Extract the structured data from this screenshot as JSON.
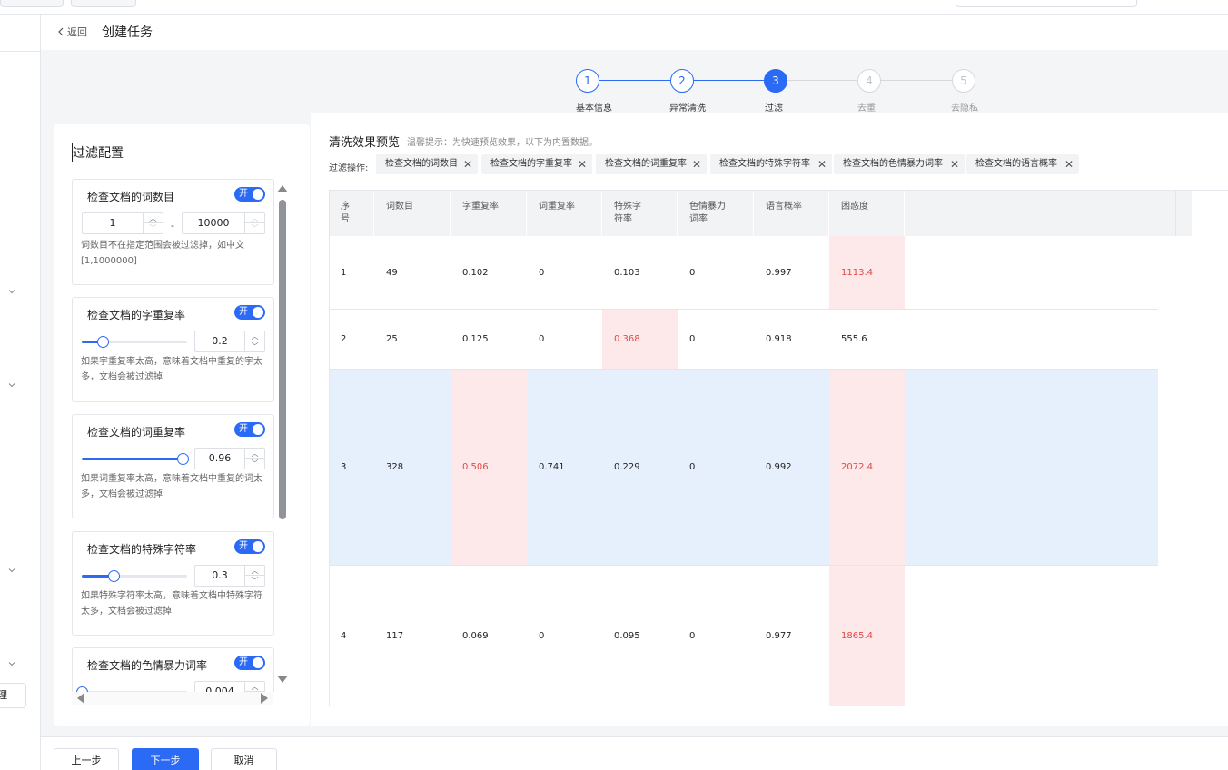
{
  "header": {
    "back_label": "返回",
    "title": "创建任务"
  },
  "nav": {
    "partial_item_label": "理"
  },
  "steps": [
    {
      "num": "1",
      "label": "基本信息",
      "state": "done"
    },
    {
      "num": "2",
      "label": "异常清洗",
      "state": "done"
    },
    {
      "num": "3",
      "label": "过滤",
      "state": "active"
    },
    {
      "num": "4",
      "label": "去重",
      "state": "todo"
    },
    {
      "num": "5",
      "label": "去隐私",
      "state": "todo"
    }
  ],
  "config": {
    "title": "过滤配置",
    "cards": [
      {
        "name": "检查文档的词数目",
        "switch_label": "开",
        "min": "1",
        "dash": "-",
        "max": "10000",
        "desc": "词数目不在指定范围会被过滤掉，如中文[1,1000000]"
      },
      {
        "name": "检查文档的字重复率",
        "switch_label": "开",
        "value": "0.2",
        "level": 0.2,
        "desc": "如果字重复率太高，意味着文档中重复的字太多，文档会被过滤掉"
      },
      {
        "name": "检查文档的词重复率",
        "switch_label": "开",
        "value": "0.96",
        "level": 0.96,
        "desc": "如果词重复率太高，意味着文档中重复的词太多，文档会被过滤掉"
      },
      {
        "name": "检查文档的特殊字符率",
        "switch_label": "开",
        "value": "0.3",
        "level": 0.3,
        "desc": "如果特殊字符率太高，意味着文档中特殊字符太多，文档会被过滤掉"
      },
      {
        "name": "检查文档的色情暴力词率",
        "switch_label": "开",
        "value": "0.004",
        "level": 0.0
      }
    ]
  },
  "preview": {
    "title": "清洗效果预览",
    "hint": "温馨提示：为快速预览效果，以下为内置数据。",
    "filter_label": "过滤操作:",
    "chips": [
      "检查文档的词数目",
      "检查文档的字重复率",
      "检查文档的词重复率",
      "检查文档的特殊字符率",
      "检查文档的色情暴力词率",
      "检查文档的语言概率"
    ],
    "columns": [
      "序号",
      "词数目",
      "字重复率",
      "词重复率",
      "特殊字符率",
      "色情暴力词率",
      "语言概率",
      "困惑度"
    ],
    "rows": [
      {
        "cells": [
          "1",
          "49",
          "0.102",
          "0",
          "0.103",
          "0",
          "0.997",
          "1113.4"
        ],
        "bad": [
          7
        ]
      },
      {
        "cells": [
          "2",
          "25",
          "0.125",
          "0",
          "0.368",
          "0",
          "0.918",
          "555.6"
        ],
        "bad": [
          4
        ]
      },
      {
        "cells": [
          "3",
          "328",
          "0.506",
          "0.741",
          "0.229",
          "0",
          "0.992",
          "2072.4"
        ],
        "bad": [
          2,
          7
        ]
      },
      {
        "cells": [
          "4",
          "117",
          "0.069",
          "0",
          "0.095",
          "0",
          "0.977",
          "1865.4"
        ],
        "bad": [
          7
        ]
      }
    ]
  },
  "footer": {
    "prev_label": "上一步",
    "next_label": "下一步",
    "cancel_label": "取消"
  },
  "colors": {
    "primary": "#2a6af4",
    "bad_bg": "#fde9e9",
    "bad_text": "#e24848",
    "row_highlight": "#e6f0fd"
  }
}
